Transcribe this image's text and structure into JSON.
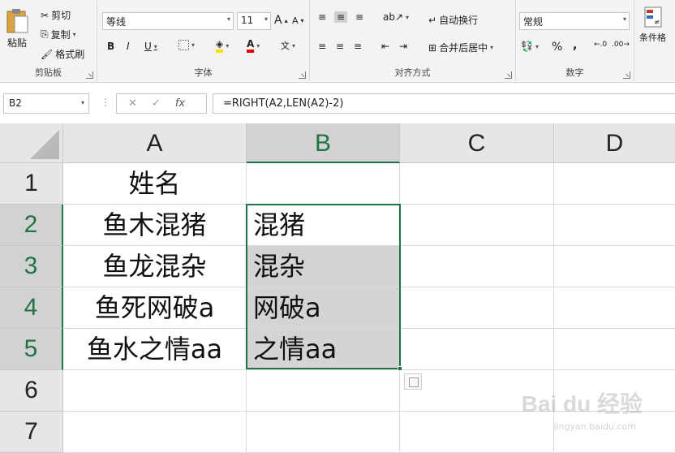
{
  "ribbon": {
    "clipboard": {
      "paste_label": "粘贴",
      "cut_label": "剪切",
      "copy_label": "复制",
      "format_painter_label": "格式刷",
      "group_label": "剪贴板"
    },
    "font": {
      "font_name": "等线",
      "font_size": "11",
      "bold": "B",
      "italic": "I",
      "underline": "U",
      "group_label": "字体"
    },
    "alignment": {
      "wrap_text_label": "自动换行",
      "merge_center_label": "合并后居中",
      "group_label": "对齐方式"
    },
    "number": {
      "format": "常规",
      "percent": "%",
      "comma": ",",
      "group_label": "数字"
    },
    "styles": {
      "conditional_format_label": "条件格"
    }
  },
  "formula_bar": {
    "name_box": "B2",
    "formula": "=RIGHT(A2,LEN(A2)-2)"
  },
  "grid": {
    "columns": [
      "A",
      "B",
      "C",
      "D"
    ],
    "rows": [
      "1",
      "2",
      "3",
      "4",
      "5",
      "6",
      "7"
    ],
    "col_a": [
      "姓名",
      "鱼木混猪",
      "鱼龙混杂",
      "鱼死网破a",
      "鱼水之情aa",
      "",
      ""
    ],
    "col_b": [
      "",
      "混猪",
      "混杂",
      "网破a",
      "之情aa",
      "",
      ""
    ],
    "selected_column": "B",
    "selection": "B2:B5"
  },
  "watermark": {
    "text": "Bai du 经验",
    "sub": "jingyan.baidu.com"
  },
  "colors": {
    "accent": "#217346",
    "header_bg": "#e6e6e6",
    "selected_fill": "#d4d4d4"
  }
}
